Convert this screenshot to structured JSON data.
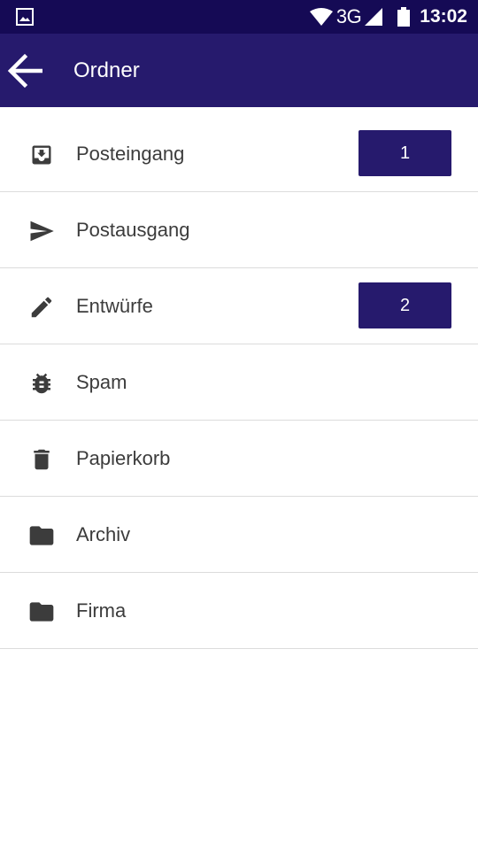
{
  "status_bar": {
    "network": "3G",
    "time": "13:02",
    "icons": [
      "gallery-icon",
      "wifi-icon",
      "signal-icon",
      "battery-icon"
    ]
  },
  "app_bar": {
    "title": "Ordner",
    "back_icon": "arrow-back-icon",
    "background": "#261a6d"
  },
  "folders": [
    {
      "label": "Posteingang",
      "icon": "inbox-download-icon",
      "count": "1"
    },
    {
      "label": "Postausgang",
      "icon": "send-icon",
      "count": ""
    },
    {
      "label": "Entwürfe",
      "icon": "pencil-icon",
      "count": "2"
    },
    {
      "label": "Spam",
      "icon": "bug-icon",
      "count": ""
    },
    {
      "label": "Papierkorb",
      "icon": "trash-icon",
      "count": ""
    },
    {
      "label": "Archiv",
      "icon": "folder-icon",
      "count": ""
    },
    {
      "label": "Firma",
      "icon": "folder-icon",
      "count": ""
    }
  ],
  "colors": {
    "status_bar": "#150a55",
    "accent": "#261a6d",
    "icon": "#3c3c3c",
    "divider": "#dcdcdc"
  }
}
